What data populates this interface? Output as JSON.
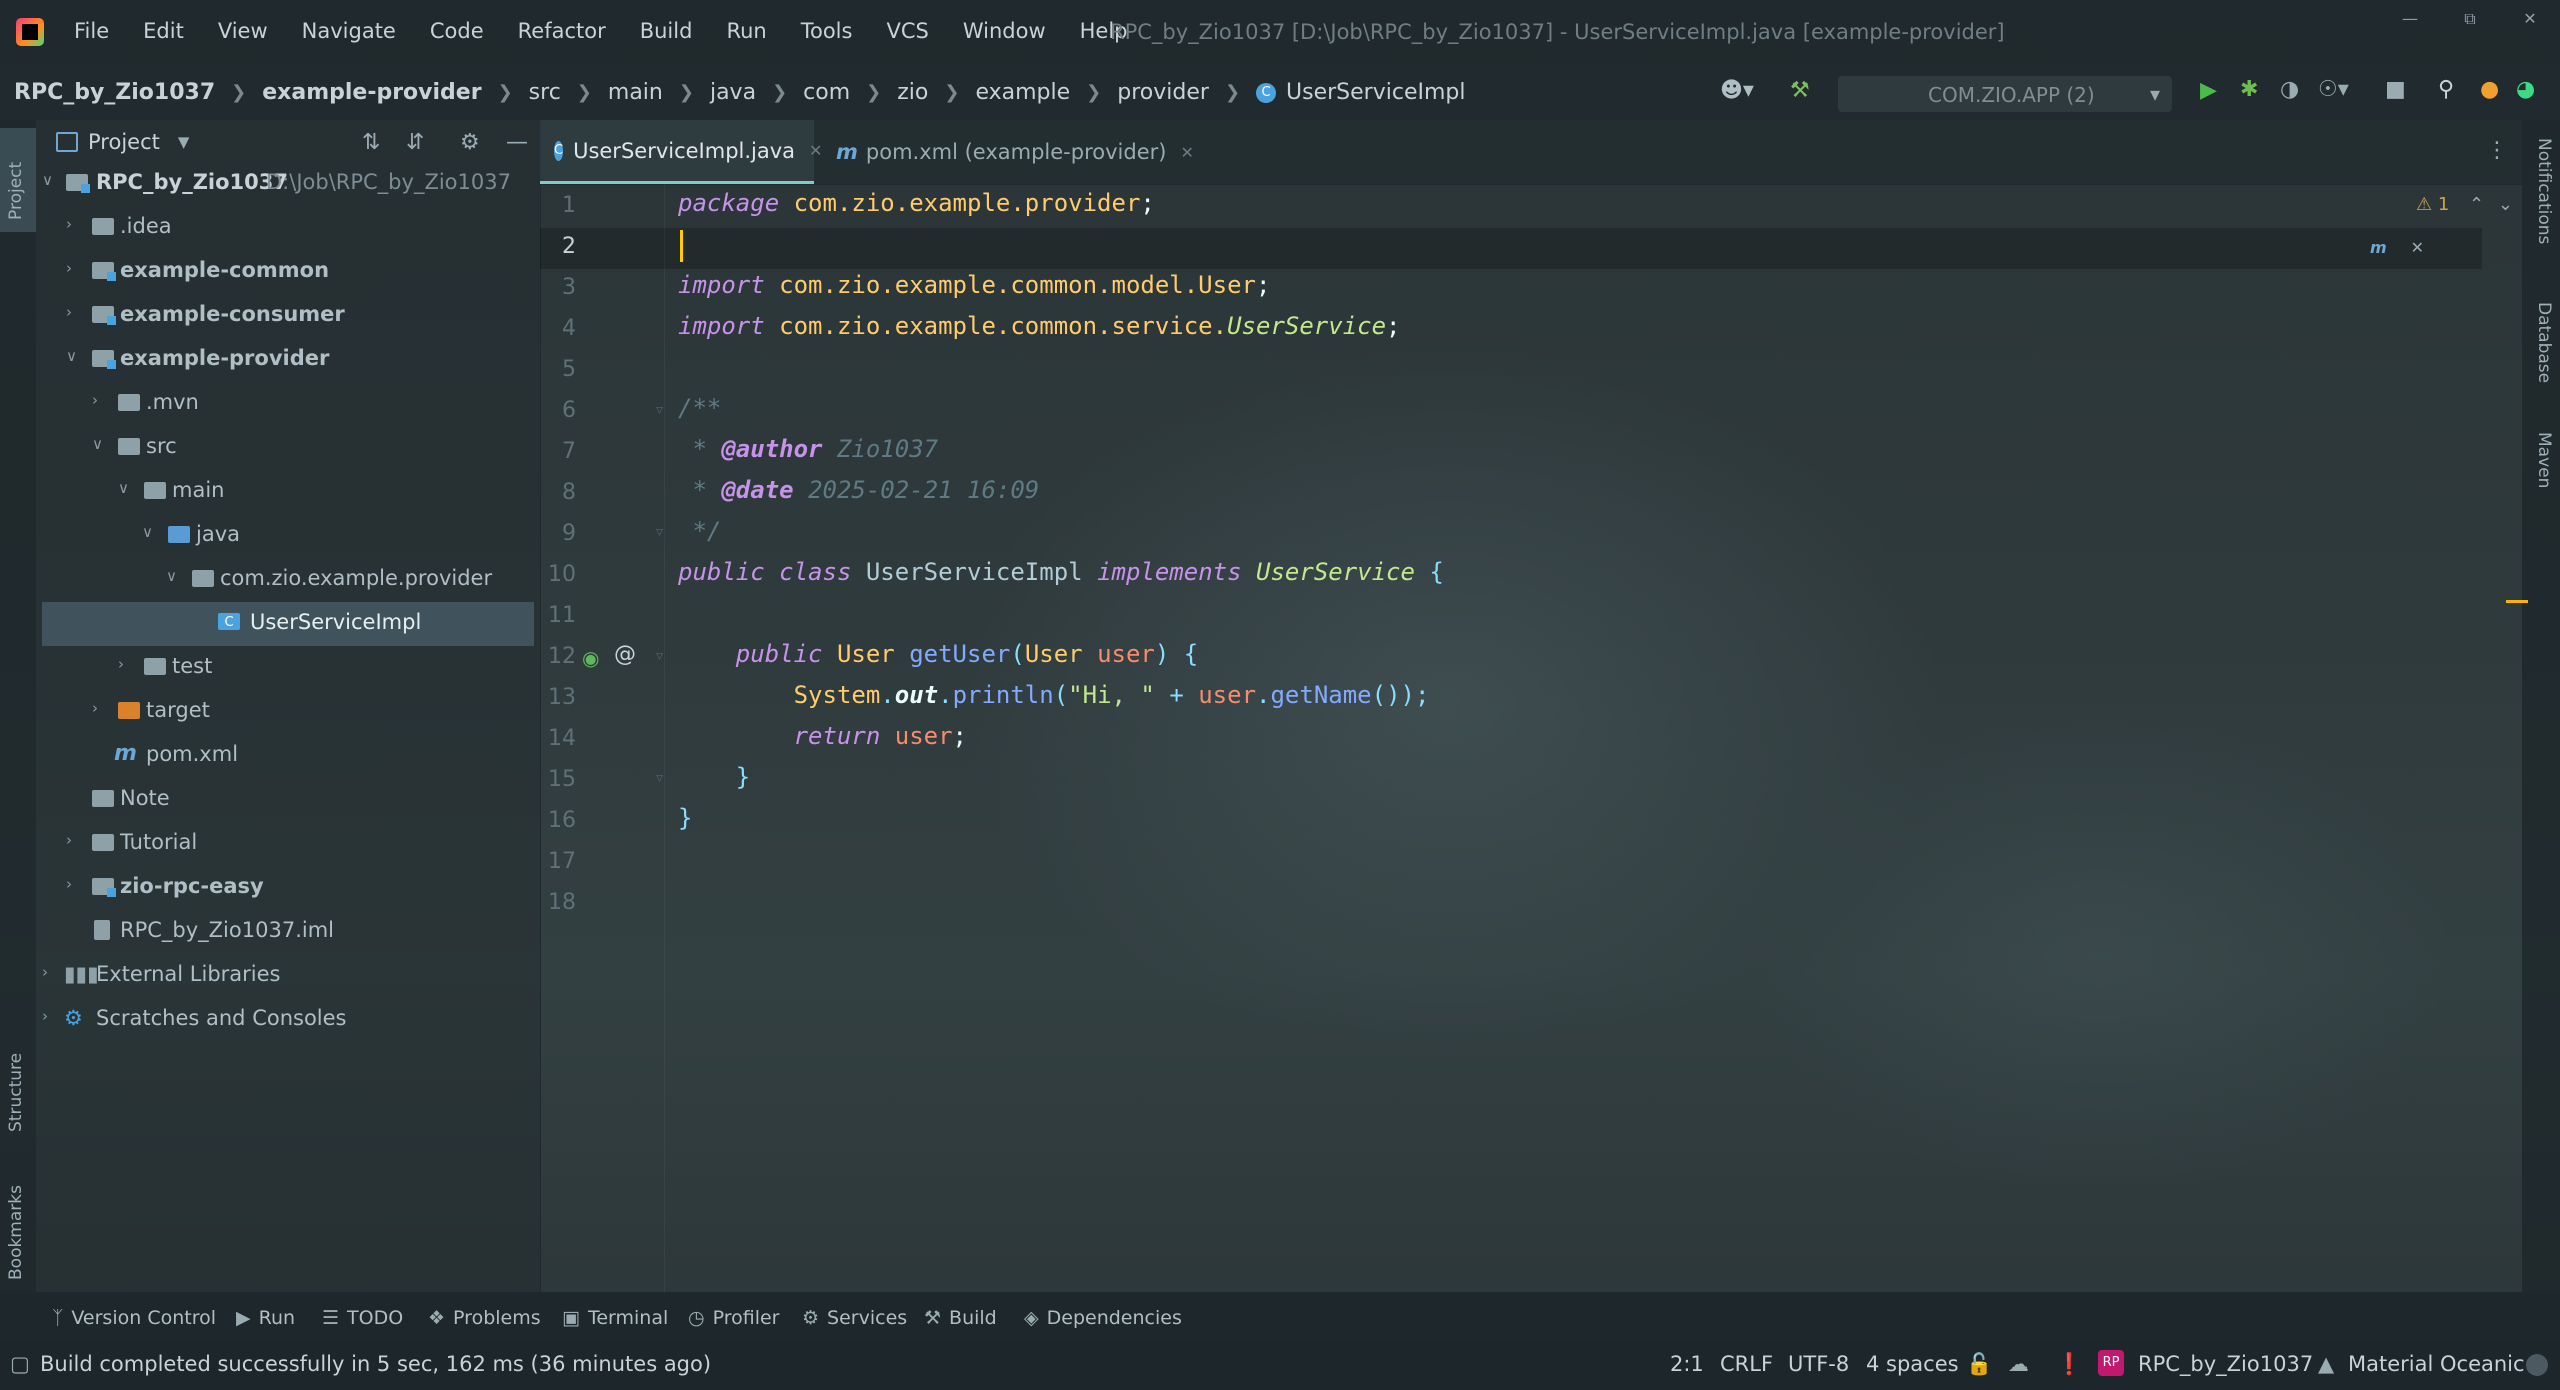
{
  "window": {
    "title": "RPC_by_Zio1037 [D:\\Job\\RPC_by_Zio1037] - UserServiceImpl.java [example-provider]",
    "menu": [
      "File",
      "Edit",
      "View",
      "Navigate",
      "Code",
      "Refactor",
      "Build",
      "Run",
      "Tools",
      "VCS",
      "Window",
      "Help"
    ]
  },
  "breadcrumb": [
    "RPC_by_Zio1037",
    "example-provider",
    "src",
    "main",
    "java",
    "com",
    "zio",
    "example",
    "provider",
    "UserServiceImpl"
  ],
  "run_config": "COM.ZIO.APP (2)",
  "left_stripe": {
    "project": "Project",
    "structure": "Structure",
    "bookmarks": "Bookmarks"
  },
  "right_stripe": {
    "notifications": "Notifications",
    "database": "Database",
    "maven": "Maven"
  },
  "project_panel": {
    "title": "Project",
    "tree": [
      {
        "label": "RPC_by_Zio1037",
        "extra": "D:\\Job\\RPC_by_Zio1037"
      },
      {
        "label": ".idea"
      },
      {
        "label": "example-common"
      },
      {
        "label": "example-consumer"
      },
      {
        "label": "example-provider"
      },
      {
        "label": ".mvn"
      },
      {
        "label": "src"
      },
      {
        "label": "main"
      },
      {
        "label": "java"
      },
      {
        "label": "com.zio.example.provider"
      },
      {
        "label": "UserServiceImpl"
      },
      {
        "label": "test"
      },
      {
        "label": "target"
      },
      {
        "label": "pom.xml"
      },
      {
        "label": "Note"
      },
      {
        "label": "Tutorial"
      },
      {
        "label": "zio-rpc-easy"
      },
      {
        "label": "RPC_by_Zio1037.iml"
      },
      {
        "label": "External Libraries"
      },
      {
        "label": "Scratches and Consoles"
      }
    ]
  },
  "tabs": [
    {
      "label": "UserServiceImpl.java",
      "active": true
    },
    {
      "label": "pom.xml (example-provider)",
      "active": false
    }
  ],
  "editor": {
    "warning_count": "1",
    "line_numbers": [
      "1",
      "2",
      "3",
      "4",
      "5",
      "6",
      "7",
      "8",
      "9",
      "10",
      "11",
      "12",
      "13",
      "14",
      "15",
      "16",
      "17",
      "18"
    ],
    "tokens": {
      "package_kw": "package",
      "package_name": "com.zio.example.provider",
      "import_kw": "import",
      "import1": "com.zio.example.common.model.User",
      "import2_pkg": "com.zio.example.common.service.",
      "import2_cls": "UserService",
      "semi": ";",
      "doc_open": "/**",
      "author_tag": "@author",
      "author_val": "Zio1037",
      "date_tag": "@date",
      "date_val": "2025-02-21 16:09",
      "doc_close": "*/",
      "public": "public",
      "class": "class",
      "class_name": "UserServiceImpl",
      "implements": "implements",
      "interface_name": "UserService",
      "open_brace": "{",
      "close_brace": "}",
      "ret_type": "User",
      "method": "getUser",
      "param_type": "User",
      "param_name": "user",
      "system": "System",
      "out": "out",
      "println": "println",
      "str": "\"Hi, \"",
      "plus": " + ",
      "getName": "getName",
      "return": "return"
    }
  },
  "bottom_tools": [
    "Version Control",
    "Run",
    "TODO",
    "Problems",
    "Terminal",
    "Profiler",
    "Services",
    "Build",
    "Dependencies"
  ],
  "status": {
    "message": "Build completed successfully in 5 sec, 162 ms (36 minutes ago)",
    "position": "2:1",
    "line_sep": "CRLF",
    "encoding": "UTF-8",
    "indent": "4 spaces",
    "project": "RPC_by_Zio1037",
    "theme": "Material Oceanic"
  },
  "colors": {
    "accent": "#80CBC4",
    "keyword": "#C792EA",
    "type": "#FFCB6B",
    "function": "#82AAFF",
    "string": "#C3E88D"
  }
}
